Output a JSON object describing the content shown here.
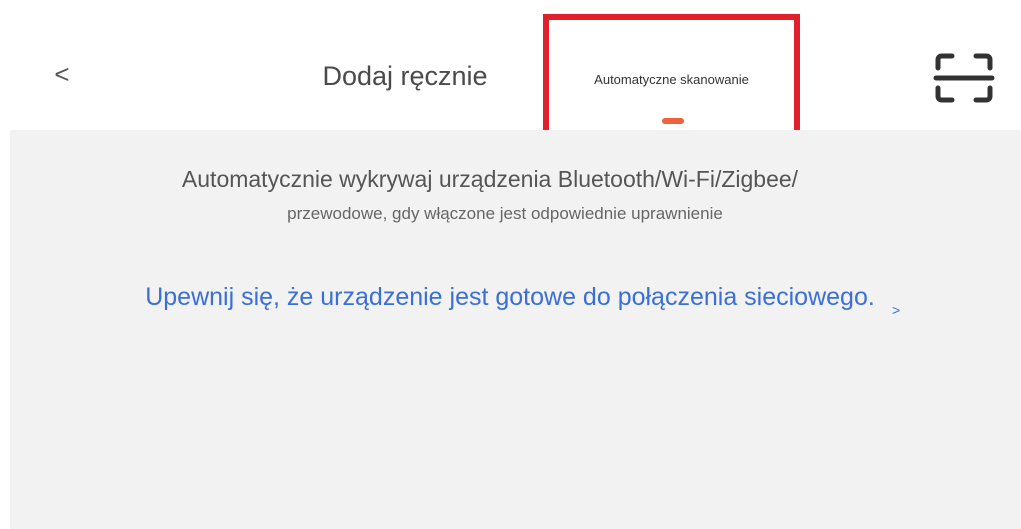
{
  "header": {
    "back_label": "<",
    "tabs": [
      {
        "label": "Dodaj ręcznie",
        "active": false
      },
      {
        "label": "Automatyczne skanowanie",
        "active": true
      }
    ],
    "scan_icon": "scan-frame-icon"
  },
  "main": {
    "description_line1": "Automatycznie wykrywaj urządzenia Bluetooth/Wi-Fi/Zigbee/",
    "description_line2": "przewodowe, gdy włączone jest odpowiednie uprawnienie",
    "ready_link": "Upewnij się, że urządzenie jest gotowe do połączenia sieciowego.",
    "ready_chevron": ">"
  },
  "colors": {
    "highlight_box": "#e0202a",
    "tab_indicator": "#f0603a",
    "link": "#3a6fd8",
    "content_bg": "#f2f2f2"
  }
}
